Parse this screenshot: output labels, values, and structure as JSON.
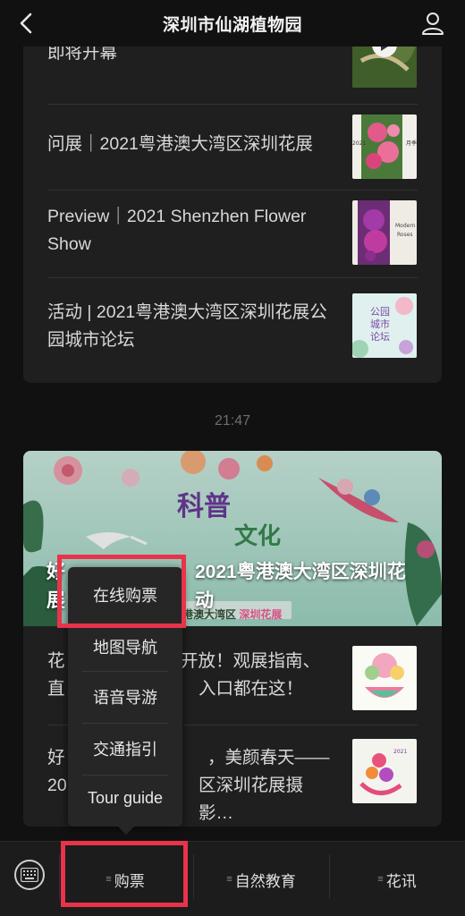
{
  "header": {
    "title": "深圳市仙湖植物园"
  },
  "card1": {
    "items": [
      {
        "text": "即将开幕",
        "thumb": "video-thumbnail"
      },
      {
        "text": "问展｜2021粤港澳大湾区深圳花展",
        "thumb": "flower-poster-pink",
        "thumb_text": "2021 深圳花展"
      },
      {
        "text": "Preview｜2021 Shenzhen Flower Show",
        "thumb": "flower-poster-purple"
      },
      {
        "text": "活动 | 2021粤港澳大湾区深圳花展公园城市论坛",
        "thumb": "forum-poster",
        "thumb_text": "公园城市论坛"
      }
    ]
  },
  "time_divider": "21:47",
  "card2": {
    "banner_title": "好…科普…2021粤港澳大湾区深圳花展…活动",
    "banner_title_visible": "2021粤港澳大湾区深圳花",
    "banner_tag_a": "港澳大湾区",
    "banner_tag_b": "深圳花展",
    "banner_art_1": "科普",
    "banner_art_2": "文化",
    "items": [
      {
        "text_left": "花",
        "text_right": "开放！观展指南、",
        "text_left2": "直",
        "text_right2": "入口都在这！"
      },
      {
        "text_left": "好",
        "text_right": "，美颜春天——",
        "text_left2": "20",
        "text_right2": "区深圳花展摄影…"
      }
    ]
  },
  "popup_menu": {
    "items": [
      "在线购票",
      "地图导航",
      "语音导游",
      "交通指引",
      "Tour guide"
    ]
  },
  "bottom_bar": {
    "tabs": [
      "购票",
      "自然教育",
      "花讯"
    ]
  },
  "colors": {
    "background": "#111111",
    "card": "#1f1f1f",
    "popup": "#262626",
    "highlight": "#e8334a"
  }
}
